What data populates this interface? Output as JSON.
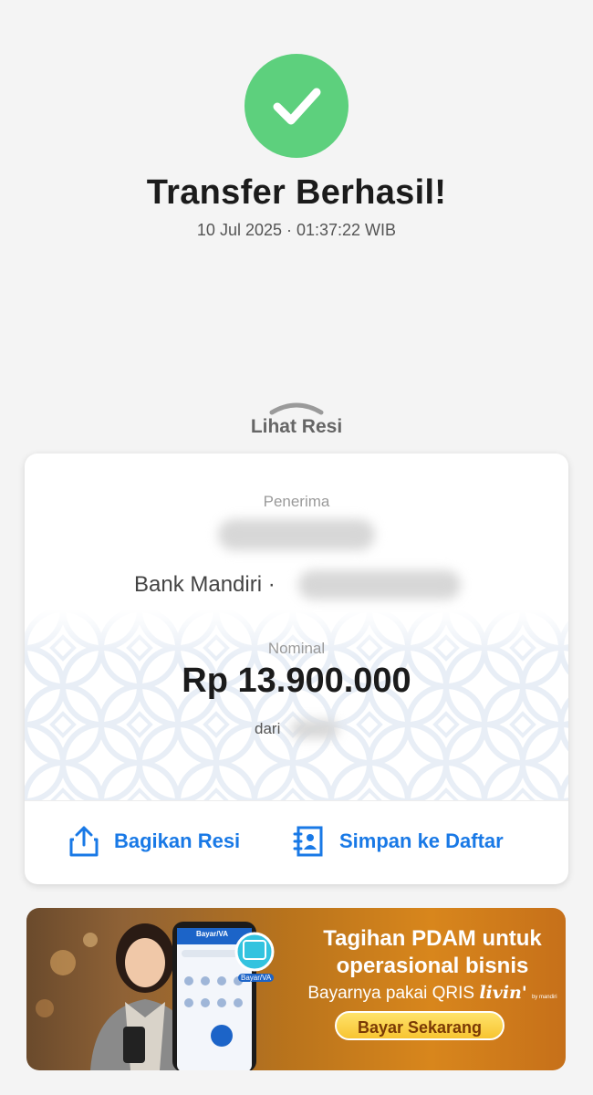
{
  "header": {
    "title": "Transfer Berhasil!",
    "datetime": "10 Jul 2025 · 01:37:22 WIB",
    "success_color": "#5dd07d"
  },
  "receipt_toggle": {
    "label": "Lihat Resi"
  },
  "receipt": {
    "recipient_label": "Penerima",
    "bank_name": "Bank Mandiri ·",
    "amount_label": "Nominal",
    "amount": "Rp 13.900.000",
    "from_label": "dari"
  },
  "actions": {
    "share_label": "Bagikan Resi",
    "save_label": "Simpan ke Daftar",
    "accent": "#1979e6"
  },
  "banner": {
    "line1": "Tagihan PDAM untuk",
    "line2": "operasional bisnis",
    "line3_prefix": "Bayarnya pakai QRIS",
    "brand": "livin'",
    "brand_sub": "by mandiri",
    "cta": "Bayar Sekarang",
    "phone_header": "Bayar/VA",
    "phone_badge": "Bayar/VA"
  }
}
